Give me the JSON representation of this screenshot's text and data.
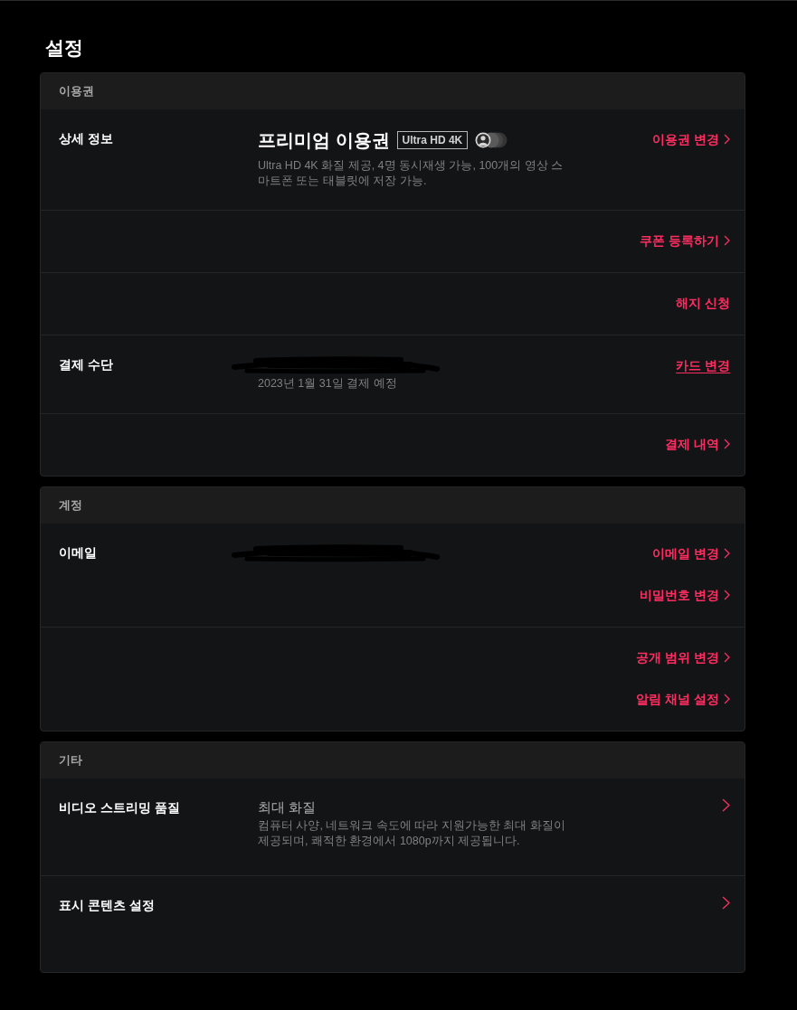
{
  "title": "설정",
  "sections": [
    {
      "heading": "이용권",
      "rows": [
        {
          "kind": "info",
          "label": "상세 정보",
          "detail": {
            "title": "프리미엄 이용권",
            "badge": "Ultra HD 4K",
            "description": "Ultra HD 4K 화질 제공, 4명 동시재생 가능, 100개의 영상 스마트폰 또는 태블릿에 저장 가능."
          },
          "links": [
            {
              "text": "이용권 변경",
              "chevron": true,
              "underlined": false
            }
          ]
        },
        {
          "kind": "action",
          "links": [
            {
              "text": "쿠폰 등록하기",
              "chevron": true,
              "underlined": false
            }
          ]
        },
        {
          "kind": "action",
          "links": [
            {
              "text": "해지 신청",
              "chevron": false,
              "underlined": false
            }
          ]
        },
        {
          "kind": "info",
          "label": "결제 수단",
          "detail": {
            "redacted": true,
            "description": "2023년 1월 31일 결제 예정"
          },
          "links": [
            {
              "text": "카드 변경",
              "chevron": false,
              "underlined": true
            }
          ]
        },
        {
          "kind": "action",
          "links": [
            {
              "text": "결제 내역",
              "chevron": true,
              "underlined": false
            }
          ]
        }
      ]
    },
    {
      "heading": "계정",
      "rows": [
        {
          "kind": "info",
          "label": "이메일",
          "detail": {
            "redacted": true
          },
          "links": [
            {
              "text": "이메일 변경",
              "chevron": true,
              "underlined": false
            },
            {
              "text": "비밀번호 변경",
              "chevron": true,
              "underlined": false
            }
          ]
        },
        {
          "kind": "action",
          "links": [
            {
              "text": "공개 범위 변경",
              "chevron": true,
              "underlined": false
            },
            {
              "text": "알림 채널 설정",
              "chevron": true,
              "underlined": false
            }
          ]
        }
      ]
    },
    {
      "heading": "기타",
      "rows": [
        {
          "kind": "nav",
          "label": "비디오 스트리밍 품질",
          "detail": {
            "value": "최대 화질",
            "description": "컴퓨터 사양, 네트워크 속도에 따라 지원가능한 최대 화질이 제공되며, 쾌적한 환경에서 1080p까지 제공됩니다."
          },
          "arrow": true
        },
        {
          "kind": "nav",
          "label": "표시 콘텐츠 설정",
          "arrow": true
        }
      ]
    }
  ]
}
